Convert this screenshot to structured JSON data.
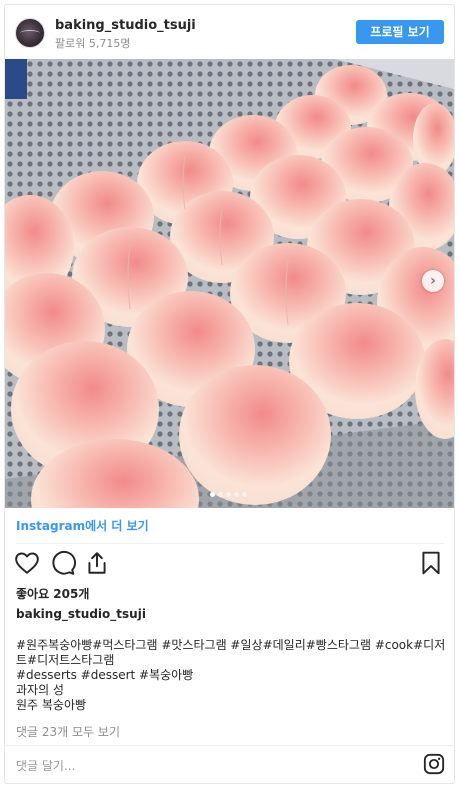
{
  "header": {
    "username": "baking_studio_tsuji",
    "followers": "팔로워 5,715명",
    "profile_button": "프로필 보기",
    "avatar_icon": "avatar-icon"
  },
  "carousel": {
    "dot_count": 5,
    "active_index": 0,
    "next_icon": "chevron-right-icon"
  },
  "view_more": "Instagram에서 더 보기",
  "actions": {
    "like_icon": "heart-icon",
    "comment_icon": "comment-icon",
    "share_icon": "share-icon",
    "save_icon": "bookmark-icon"
  },
  "likes": "좋아요 205개",
  "post_user": "baking_studio_tsuji",
  "caption": {
    "tags_line1": "#원주복숭아빵#먹스타그램 #맛스타그램 #일상#데일리#빵스타그램 #cook#디저트#디저트스타그램",
    "tags_line2": "#desserts #dessert #복숭아빵",
    "line3": "과자의 성",
    "line4": "원주 복숭아빵"
  },
  "comments_link": "댓글 23개 모두 보기",
  "comment_placeholder": "댓글 달기...",
  "footer_icon": "instagram-icon",
  "colors": {
    "accent": "#3897f0",
    "hashtag": "#003569",
    "muted": "#8e8e8e"
  }
}
